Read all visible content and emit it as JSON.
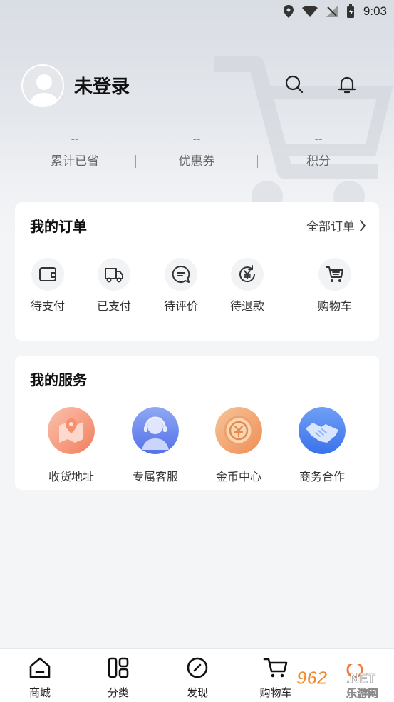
{
  "status_bar": {
    "time": "9:03"
  },
  "profile": {
    "username": "未登录"
  },
  "stats": [
    {
      "value": "--",
      "label": "累计已省"
    },
    {
      "value": "--",
      "label": "优惠券"
    },
    {
      "value": "--",
      "label": "积分"
    }
  ],
  "orders": {
    "title": "我的订单",
    "all_label": "全部订单",
    "items": [
      {
        "label": "待支付",
        "icon": "wallet-icon"
      },
      {
        "label": "已支付",
        "icon": "truck-icon"
      },
      {
        "label": "待评价",
        "icon": "comment-icon"
      },
      {
        "label": "待退款",
        "icon": "refund-icon"
      },
      {
        "label": "购物车",
        "icon": "cart-icon"
      }
    ]
  },
  "services": {
    "title": "我的服务",
    "items": [
      {
        "label": "收货地址",
        "icon": "address-icon",
        "color": "#f7a287"
      },
      {
        "label": "专属客服",
        "icon": "customer-service-icon",
        "color": "#6f8ef0"
      },
      {
        "label": "金币中心",
        "icon": "coin-icon",
        "color": "#f3a36c"
      },
      {
        "label": "商务合作",
        "icon": "handshake-icon",
        "color": "#4c86f0"
      }
    ]
  },
  "tabbar": [
    {
      "label": "商城",
      "icon": "home-icon"
    },
    {
      "label": "分类",
      "icon": "category-icon"
    },
    {
      "label": "发现",
      "icon": "compass-icon"
    },
    {
      "label": "购物车",
      "icon": "cart-icon"
    }
  ],
  "watermark": {
    "text": "962.NET",
    "subtext": "乐游网"
  }
}
